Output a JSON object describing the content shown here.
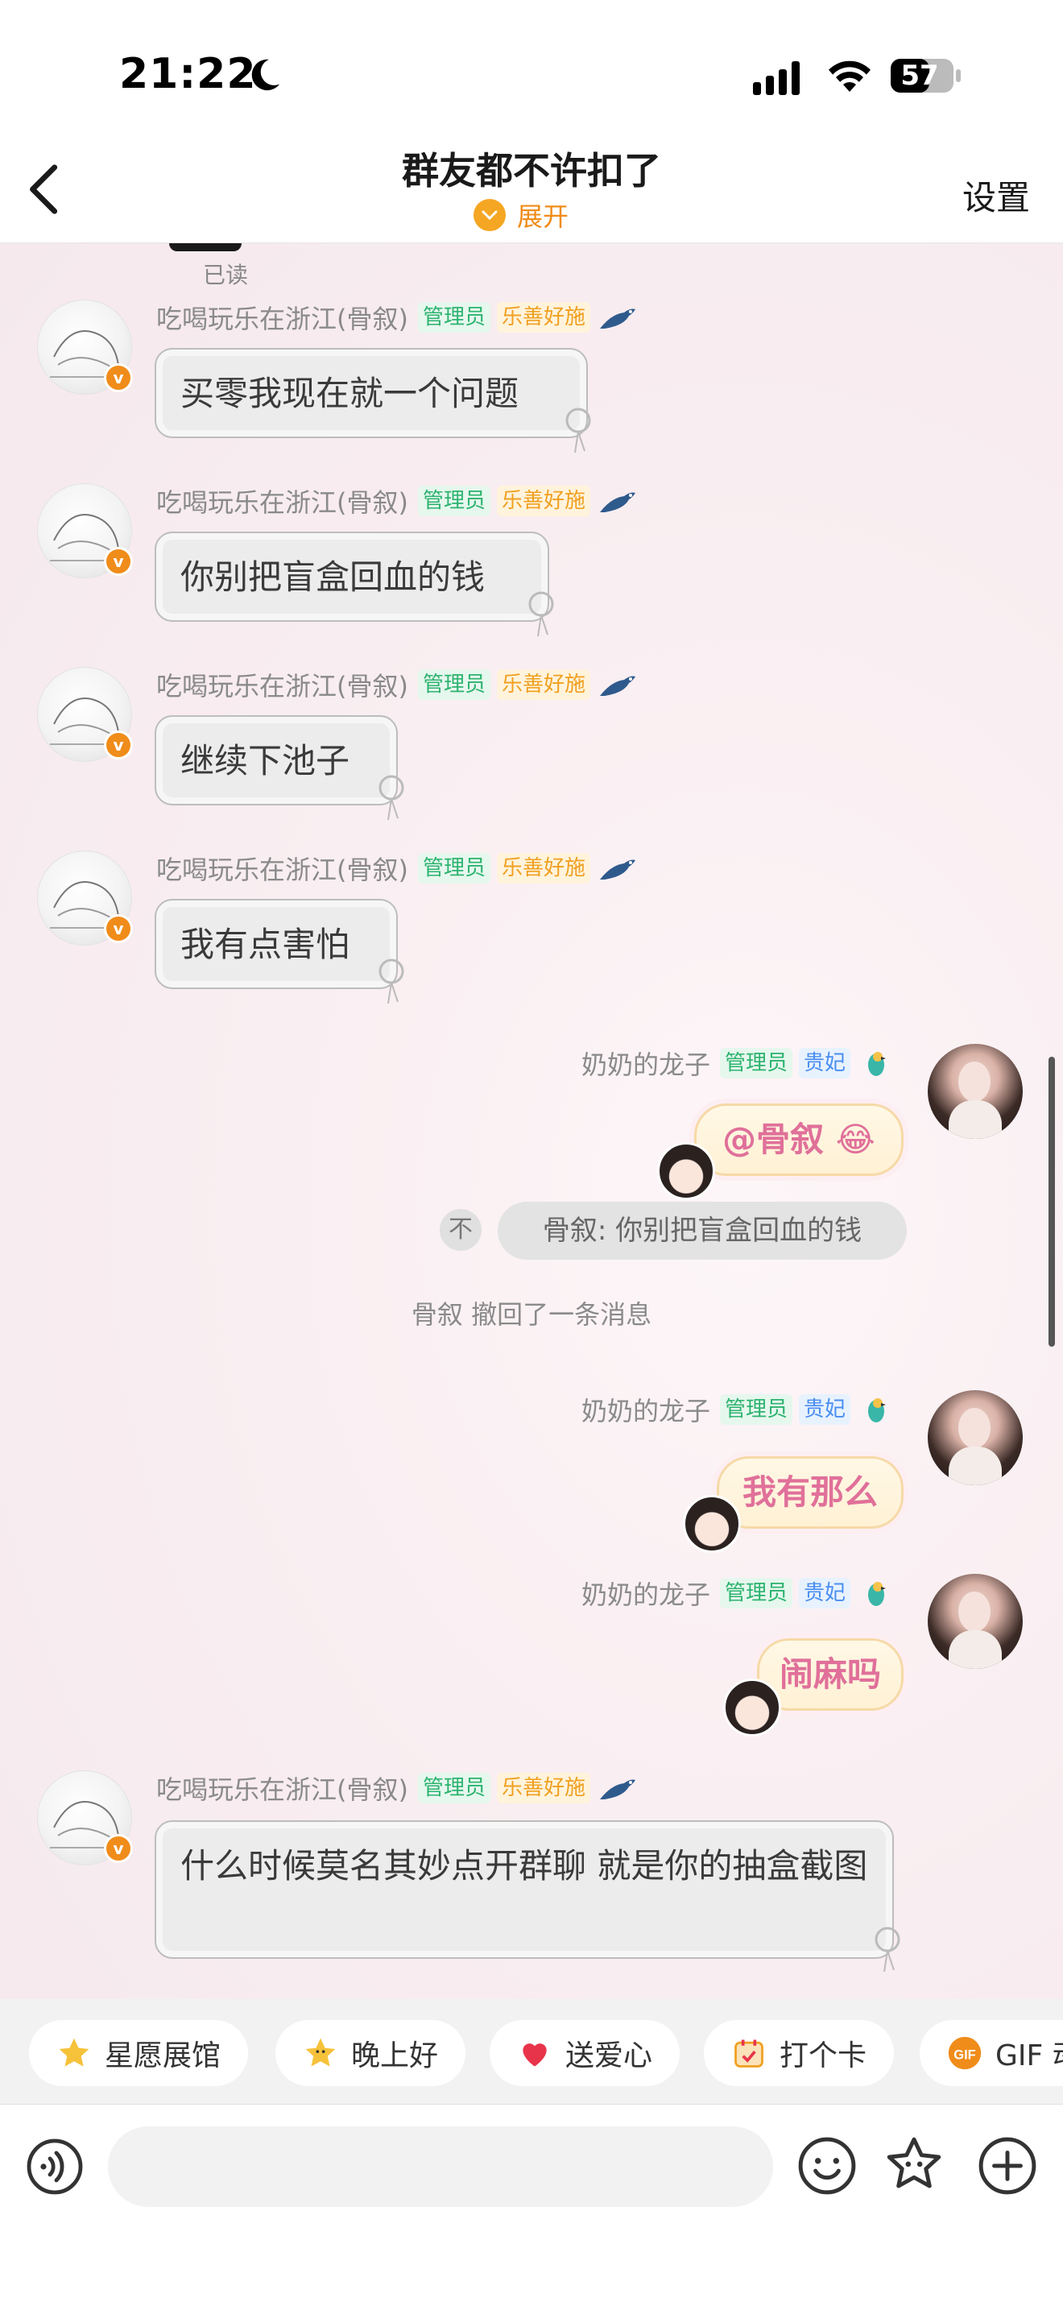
{
  "status_bar": {
    "time": "21:22",
    "battery": "57"
  },
  "header": {
    "title": "群友都不许扣了",
    "expand_label": "展开",
    "settings_label": "设置"
  },
  "read_receipt": "已读",
  "messages_left": [
    {
      "sender": "吃喝玩乐在浙江(骨叙)",
      "tags": [
        "管理员",
        "乐善好施"
      ],
      "text": "买零我现在就一个问题"
    },
    {
      "sender": "吃喝玩乐在浙江(骨叙)",
      "tags": [
        "管理员",
        "乐善好施"
      ],
      "text": "你别把盲盒回血的钱"
    },
    {
      "sender": "吃喝玩乐在浙江(骨叙)",
      "tags": [
        "管理员",
        "乐善好施"
      ],
      "text": "继续下池子"
    },
    {
      "sender": "吃喝玩乐在浙江(骨叙)",
      "tags": [
        "管理员",
        "乐善好施"
      ],
      "text": "我有点害怕"
    },
    {
      "sender": "吃喝玩乐在浙江(骨叙)",
      "tags": [
        "管理员",
        "乐善好施"
      ],
      "text": "什么时候莫名其妙点开群聊 就是你的抽盒截图"
    }
  ],
  "messages_right": [
    {
      "sender": "奶奶的龙子",
      "tags": [
        "管理员",
        "贵妃"
      ],
      "text": "@骨叙"
    },
    {
      "sender": "奶奶的龙子",
      "tags": [
        "管理员",
        "贵妃"
      ],
      "text": "我有那么"
    },
    {
      "sender": "奶奶的龙子",
      "tags": [
        "管理员",
        "贵妃"
      ],
      "text": "闹麻吗"
    }
  ],
  "quote": {
    "text": "骨叙: 你别把盲盒回血的钱",
    "icon_label": "不"
  },
  "recall_notice": "骨叙 撤回了一条消息",
  "quick_replies": [
    {
      "label": "星愿展馆",
      "icon": "star-icon"
    },
    {
      "label": "晚上好",
      "icon": "star-smile-icon"
    },
    {
      "label": "送爱心",
      "icon": "heart-icon"
    },
    {
      "label": "打个卡",
      "icon": "calendar-icon"
    },
    {
      "label": "GIF 动",
      "icon": "gif-icon"
    }
  ],
  "input": {
    "placeholder": ""
  },
  "colors": {
    "accent": "#f08c1a",
    "admin_tag": "#2db36f",
    "good_tag": "#f0a020",
    "fei_tag": "#4a8ef0"
  }
}
